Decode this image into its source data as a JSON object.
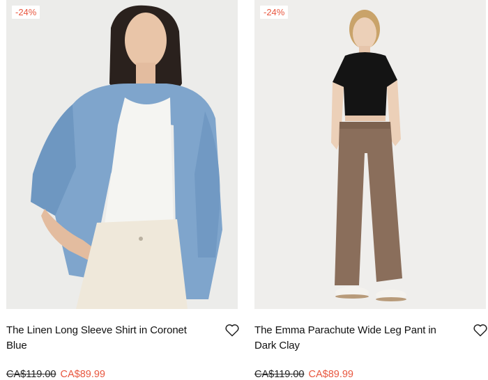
{
  "products": [
    {
      "badge": "-24%",
      "title": "The Linen Long Sleeve Shirt in Coronet Blue",
      "original_price": "CA$119.00",
      "sale_price": "CA$89.99"
    },
    {
      "badge": "-24%",
      "title": "The Emma Parachute Wide Leg Pant in Dark Clay",
      "original_price": "CA$119.00",
      "sale_price": "CA$89.99"
    }
  ],
  "icons": {
    "wishlist": "heart-outline-icon"
  },
  "colors": {
    "sale": "#e8573f",
    "badge_text": "#e8573f",
    "text": "#111111"
  }
}
